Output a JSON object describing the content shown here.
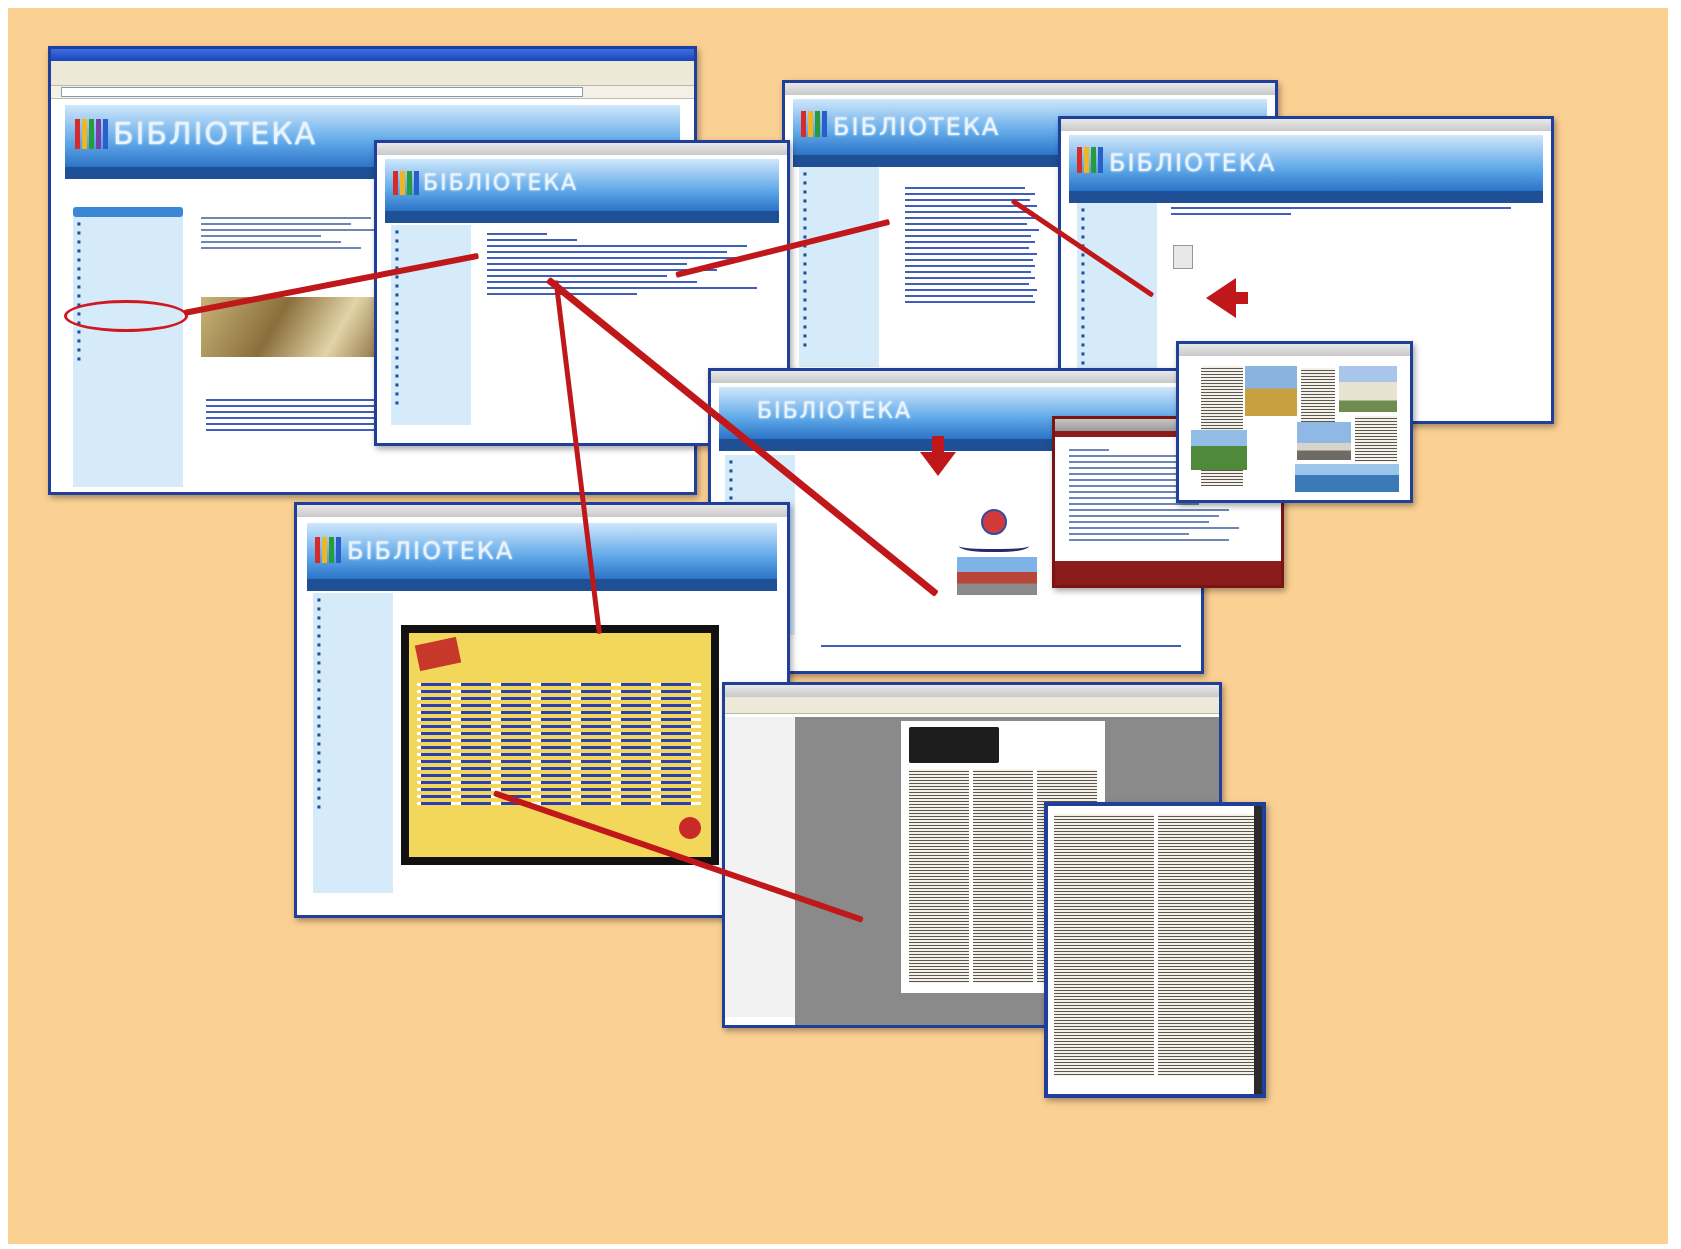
{
  "colors": {
    "background": "#fbd093",
    "window_border": "#1f3f9a",
    "arrow": "#c0181a",
    "highlight_circle": "#d01820",
    "nav_bar": "#1f4f94",
    "sidebar": "#d6ebfa"
  },
  "site": {
    "logo_text": "БІБЛІОТЕКА"
  },
  "icons": [
    "arrow-right-icon",
    "arrow-down-icon",
    "arrow-left-icon",
    "library-logo-icon"
  ]
}
